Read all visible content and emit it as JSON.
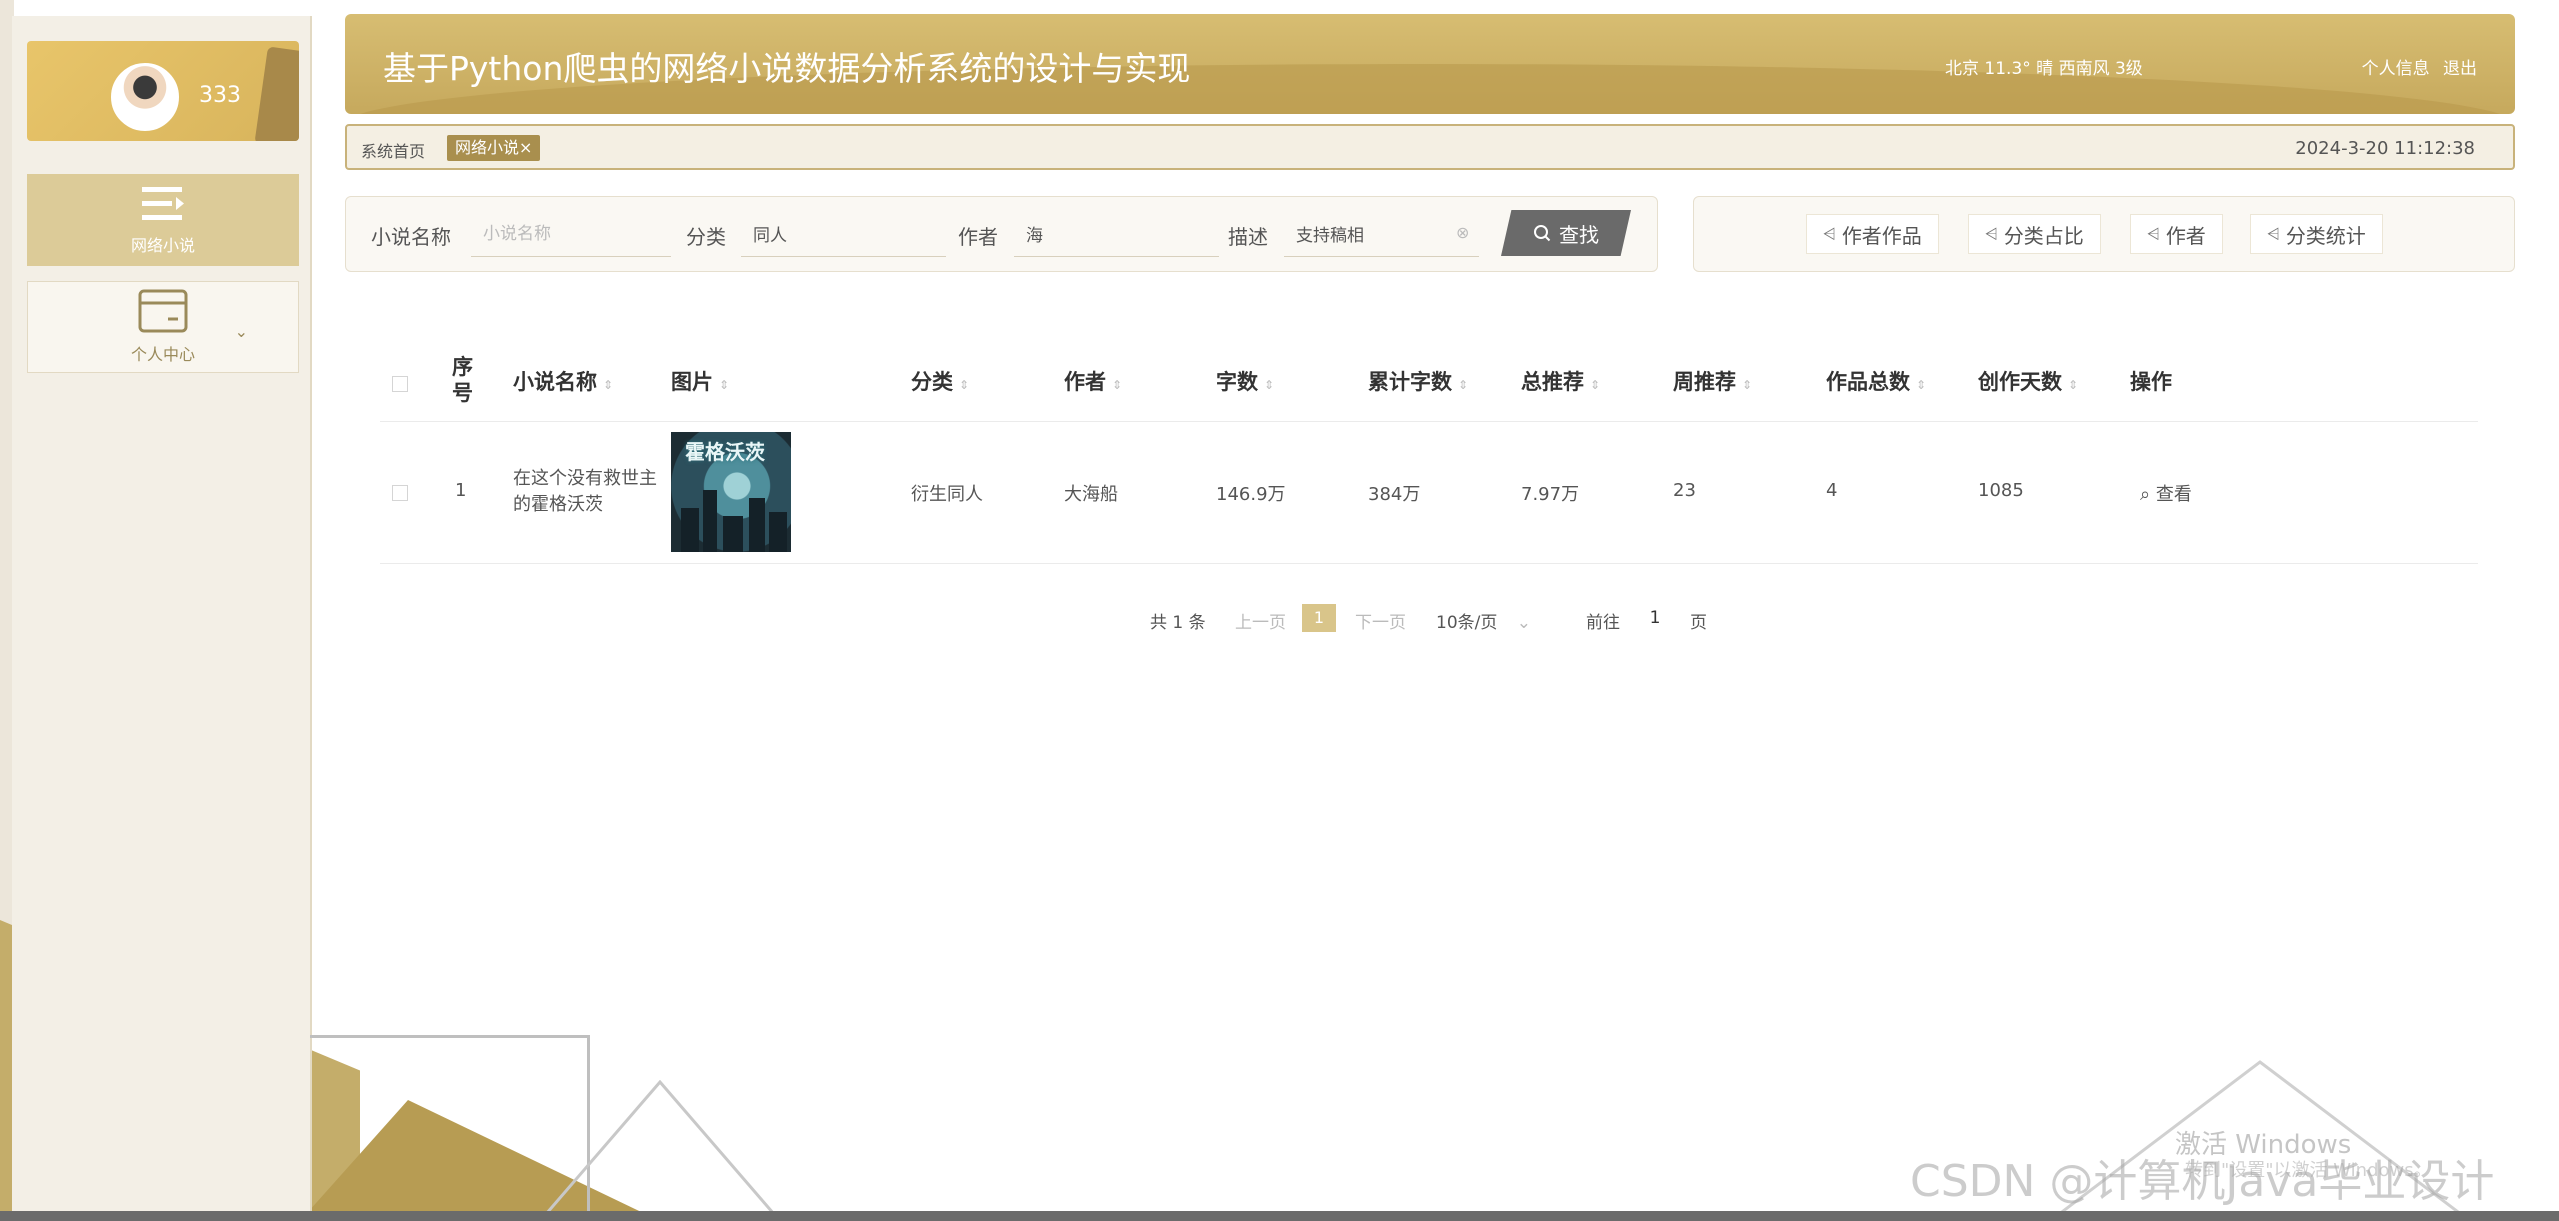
{
  "sidebar": {
    "username": "333",
    "menu": [
      {
        "label": "网络小说",
        "icon": "menu-lines-icon",
        "active": true
      },
      {
        "label": "个人中心",
        "icon": "card-icon",
        "active": false
      }
    ]
  },
  "header": {
    "title": "基于Python爬虫的网络小说数据分析系统的设计与实现",
    "weather": "北京  11.3°  晴  西南风  3级",
    "profile_link": "个人信息",
    "logout_link": "退出"
  },
  "tabs": {
    "home": "系统首页",
    "active": "网络小说",
    "close": "×",
    "datetime": "2024-3-20 11:12:38"
  },
  "search": {
    "name_label": "小说名称",
    "name_placeholder": "小说名称",
    "category_label": "分类",
    "category_value": "同人",
    "author_label": "作者",
    "author_value": "海",
    "desc_label": "描述",
    "desc_value": "支持稿相",
    "button_label": "查找"
  },
  "chart_buttons": [
    "作者作品",
    "分类占比",
    "作者",
    "分类统计"
  ],
  "table": {
    "headers": {
      "index": "序号",
      "name": "小说名称",
      "image": "图片",
      "category": "分类",
      "author": "作者",
      "words": "字数",
      "total_words": "累计字数",
      "total_recommend": "总推荐",
      "week_recommend": "周推荐",
      "works": "作品总数",
      "days": "创作天数",
      "actions": "操作"
    },
    "rows": [
      {
        "index": "1",
        "name": "在这个没有救世主的霍格沃茨",
        "cover_title": "霍格沃茨",
        "category": "衍生同人",
        "author": "大海船",
        "words": "146.9万",
        "total_words": "384万",
        "total_recommend": "7.97万",
        "week_recommend": "23",
        "works": "4",
        "days": "1085",
        "action": "查看"
      }
    ]
  },
  "pagination": {
    "total": "共 1 条",
    "prev": "上一页",
    "current": "1",
    "next": "下一页",
    "page_size": "10条/页",
    "goto_prefix": "前往",
    "goto_value": "1",
    "goto_suffix": "页"
  },
  "watermarks": {
    "activate": "激活 Windows",
    "activate_sub": "转到\"设置\"以激活 Windows。",
    "csdn": "CSDN @计算机Java毕业设计"
  }
}
